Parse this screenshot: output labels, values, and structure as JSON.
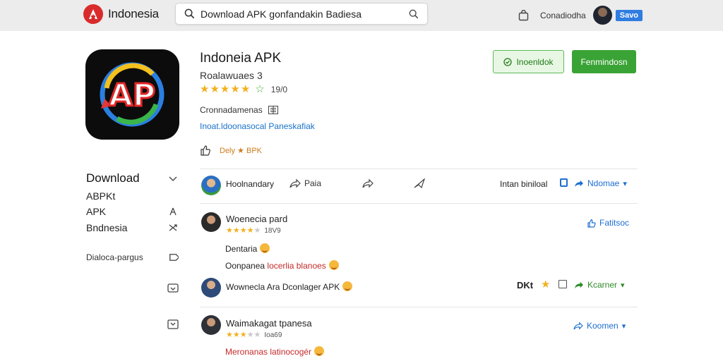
{
  "header": {
    "brand": "Indonesia",
    "search_value": "Download APK gonfandakin Badiesa",
    "right_label": "Conadiodha",
    "save_label": "Savo"
  },
  "app": {
    "title": "Indoneia APK",
    "developer": "Roalawuaes 3",
    "rating_count": "19/0",
    "category": "Cronnadamenas",
    "link_text": "Inoat.ldoonasocal Paneskafiak",
    "meta": "Dely ★ BPK",
    "install_label": "Inoenldok",
    "download_label": "Fenmindosn",
    "icon_letters": "AP"
  },
  "sidebar": {
    "heading": "Download",
    "items": [
      "ABPKt",
      "APK",
      "Bndnesia"
    ],
    "footer": "Dialoca-pargus"
  },
  "reviews": [
    {
      "author": "Hoolnandary",
      "share": "Paia",
      "meta": "Intan biniloal",
      "action": "Ndomae"
    },
    {
      "author": "Woenecia pard",
      "count": "18V9",
      "text": "Dentaria",
      "reply_prefix": "Oonpanea",
      "reply_red": "locerlia blanoes",
      "action": "Fatitsoc"
    },
    {
      "author": "Wownecla Ara Dconlager APK",
      "tag": "DKt",
      "action": "Kcarner"
    },
    {
      "author": "Waimakagat tpanesa",
      "count": "Ioa69",
      "text": "Meronanas latinocogér",
      "action": "Koomen"
    }
  ],
  "colors": {
    "accent_green": "#3aa335",
    "link_blue": "#1a73c8",
    "star": "#f2b01e",
    "brand_red": "#d92b2b"
  }
}
